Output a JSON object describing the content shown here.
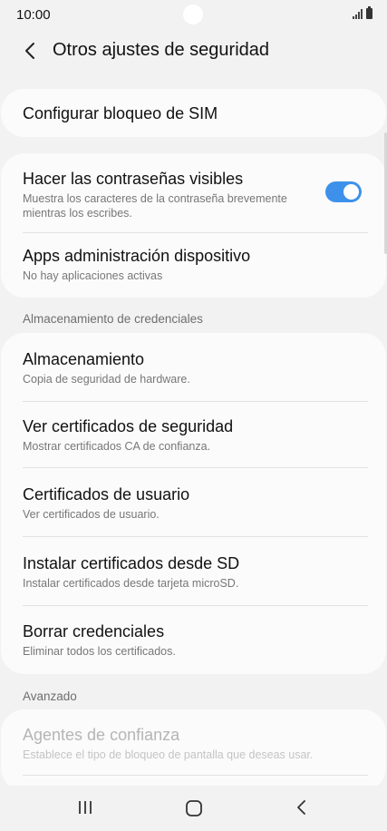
{
  "status_bar": {
    "time": "10:00"
  },
  "header": {
    "title": "Otros ajustes de seguridad"
  },
  "sim_lock": {
    "title": "Configurar bloqueo de SIM"
  },
  "group1": {
    "visible_passwords": {
      "title": "Hacer las contraseñas visibles",
      "subtitle": "Muestra los caracteres de la contraseña brevemente mientras los escribes.",
      "toggle_on": true
    },
    "device_admin": {
      "title": "Apps administración dispositivo",
      "subtitle": "No hay aplicaciones activas"
    }
  },
  "credential_storage": {
    "section_label": "Almacenamiento de credenciales",
    "items": [
      {
        "title": "Almacenamiento",
        "subtitle": "Copia de seguridad de hardware."
      },
      {
        "title": "Ver certificados de seguridad",
        "subtitle": "Mostrar certificados CA de confianza."
      },
      {
        "title": "Certificados de usuario",
        "subtitle": "Ver certificados de usuario."
      },
      {
        "title": "Instalar certificados desde SD",
        "subtitle": "Instalar certificados desde tarjeta microSD."
      },
      {
        "title": "Borrar credenciales",
        "subtitle": "Eliminar todos los certificados."
      }
    ]
  },
  "advanced": {
    "section_label": "Avanzado",
    "trust_agents": {
      "title": "Agentes de confianza",
      "subtitle": "Establece el tipo de bloqueo de pantalla que deseas usar."
    }
  },
  "colors": {
    "accent": "#3e91ea",
    "background": "#f2f2f2",
    "card": "#fbfbfb"
  },
  "nav_bar": {
    "icons": [
      "recent-apps-icon",
      "home-icon",
      "back-icon"
    ]
  }
}
